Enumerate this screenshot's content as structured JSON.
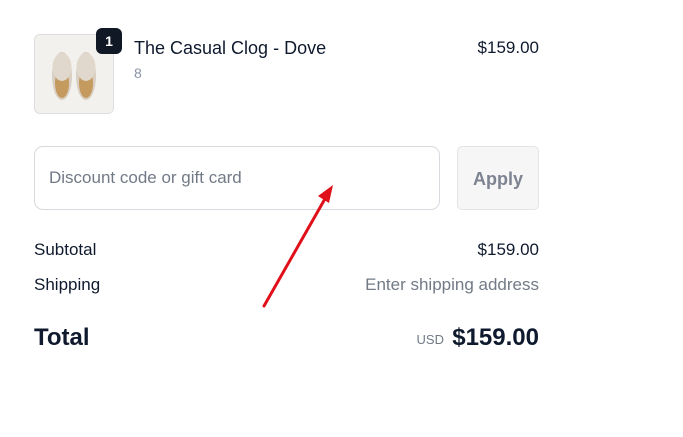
{
  "line_item": {
    "quantity": "1",
    "name": "The Casual Clog - Dove",
    "variant": "8",
    "price": "$159.00",
    "image_icon": "clog-slippers-image"
  },
  "discount": {
    "placeholder": "Discount code or gift card",
    "value": "",
    "apply_label": "Apply"
  },
  "summary": {
    "subtotal_label": "Subtotal",
    "subtotal_value": "$159.00",
    "shipping_label": "Shipping",
    "shipping_value": "Enter shipping address",
    "total_label": "Total",
    "total_currency": "USD",
    "total_value": "$159.00"
  },
  "colors": {
    "text_primary": "#0f1a2e",
    "text_muted": "#727a86",
    "badge_bg": "#101725",
    "annotation_arrow": "#e0101a"
  }
}
